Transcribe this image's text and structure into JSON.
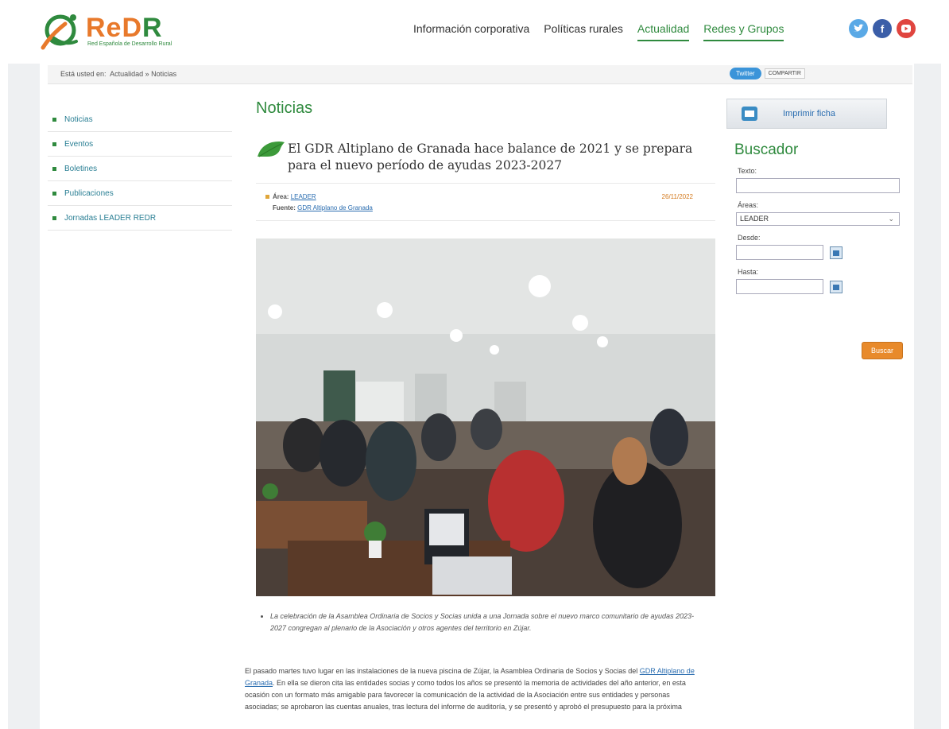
{
  "header": {
    "logo_text_1": "ReD",
    "logo_text_2": "R",
    "logo_subtitle": "Red Española de Desarrollo Rural",
    "nav": [
      {
        "label": "Información corporativa"
      },
      {
        "label": "Políticas rurales"
      },
      {
        "label": "Actualidad",
        "active": true
      },
      {
        "label": "Redes y Grupos",
        "active": true
      }
    ],
    "socials": [
      "twitter-icon",
      "facebook-icon",
      "youtube-icon"
    ]
  },
  "breadcrumb": {
    "prefix": "Está usted en:",
    "path": "Actualidad » Noticias"
  },
  "share": {
    "twitter": "Twitter",
    "compartir": "COMPARTIR"
  },
  "sidebar": {
    "items": [
      {
        "label": "Noticias"
      },
      {
        "label": "Eventos"
      },
      {
        "label": "Boletines"
      },
      {
        "label": "Publicaciones"
      },
      {
        "label": "Jornadas LEADER REDR"
      }
    ]
  },
  "main": {
    "section_title": "Noticias",
    "article_title": "El GDR Altiplano de Granada hace balance de 2021 y se prepara para el nuevo período de ayudas 2023-2027",
    "area_label": "Área:",
    "area_value": "LEADER",
    "fuente_label": "Fuente:",
    "fuente_value": "GDR Altiplano de Granada",
    "date": "26/11/2022",
    "caption": "La celebración de la Asamblea Ordinaria de Socios y Socias unida a una Jornada sobre el nuevo marco comunitario de ayudas 2023-2027 congregan al plenario de la Asociación y otros agentes del territorio en Zújar.",
    "body_1": "El pasado martes tuvo lugar en las instalaciones de la nueva piscina de Zújar, la Asamblea Ordinaria de Socios y Socias del ",
    "body_link": "GDR Altiplano de Granada",
    "body_2": ". En ella se dieron cita las entidades socias y como todos los años se presentó la memoria de actividades del año anterior, en esta ocasión con un formato más amigable para favorecer la comunicación de la actividad de la Asociación entre sus entidades y personas asociadas; se aprobaron las cuentas anuales, tras lectura del informe de auditoría, y se presentó y aprobó el presupuesto para la próxima"
  },
  "right": {
    "print_label": "Imprimir ficha",
    "buscador_title": "Buscador",
    "texto_label": "Texto:",
    "areas_label": "Áreas:",
    "areas_value": "LEADER",
    "desde_label": "Desde:",
    "hasta_label": "Hasta:",
    "buscar_label": "Buscar"
  }
}
